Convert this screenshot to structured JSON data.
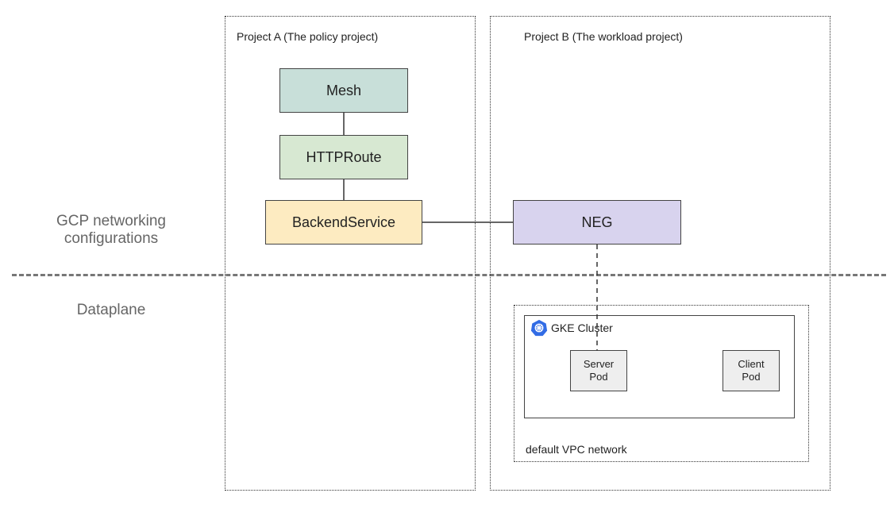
{
  "sideLabels": {
    "top": "GCP networking\nconfigurations",
    "bottom": "Dataplane"
  },
  "projectA": {
    "title": "Project A (The policy project)",
    "mesh": "Mesh",
    "httpRoute": "HTTPRoute",
    "backendService": "BackendService"
  },
  "projectB": {
    "title": "Project B (The workload project)",
    "neg": "NEG",
    "gkeCluster": "GKE Cluster",
    "serverPod": "Server\nPod",
    "clientPod": "Client\nPod",
    "vpcNetwork": "default VPC network"
  },
  "icons": {
    "k8s": "k8s-wheel-icon"
  },
  "colors": {
    "mesh": "#c8dfd9",
    "httpRoute": "#d7e8d2",
    "backendService": "#fdebc1",
    "neg": "#d8d3ee",
    "pod": "#eeeeee"
  }
}
